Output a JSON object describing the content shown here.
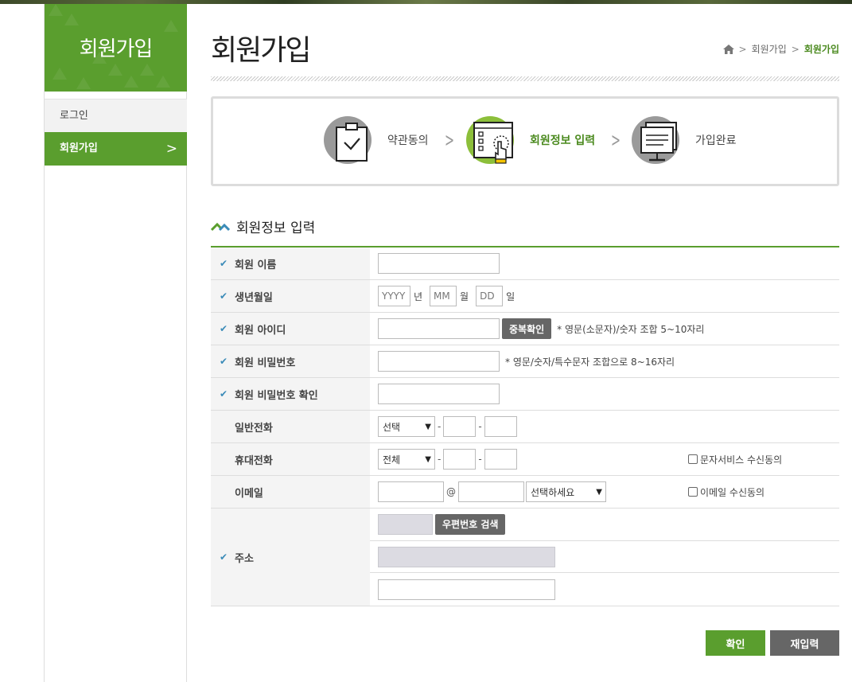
{
  "sidebar": {
    "title": "회원가입",
    "items": [
      {
        "label": "로그인"
      },
      {
        "label": "회원가입"
      }
    ]
  },
  "header": {
    "title": "회원가입",
    "breadcrumb": [
      "회원가입",
      "회원가입"
    ]
  },
  "steps": [
    {
      "label": "약관동의",
      "icon": "clipboard-check-icon"
    },
    {
      "label": "회원정보 입력",
      "icon": "form-click-icon"
    },
    {
      "label": "가입완료",
      "icon": "monitor-icon"
    }
  ],
  "section": {
    "title": "회원정보 입력"
  },
  "form": {
    "name": {
      "label": "회원 이름"
    },
    "birth": {
      "label": "생년월일",
      "year_placeholder": "YYYY",
      "year_unit": "년",
      "month_placeholder": "MM",
      "month_unit": "월",
      "day_placeholder": "DD",
      "day_unit": "일"
    },
    "userid": {
      "label": "회원 아이디",
      "button": "중복확인",
      "note": "* 영문(소문자)/숫자 조합 5~10자리"
    },
    "password": {
      "label": "회원 비밀번호",
      "note": "* 영문/숫자/특수문자 조합으로 8~16자리"
    },
    "password_confirm": {
      "label": "회원 비밀번호 확인"
    },
    "phone": {
      "label": "일반전화",
      "select": "선택",
      "dash": "-"
    },
    "mobile": {
      "label": "휴대전화",
      "select": "전체",
      "dash": "-",
      "agree": "문자서비스 수신동의"
    },
    "email": {
      "label": "이메일",
      "at": "@",
      "select": "선택하세요",
      "agree": "이메일 수신동의"
    },
    "address": {
      "label": "주소",
      "button": "우편번호 검색"
    }
  },
  "actions": {
    "confirm": "확인",
    "reset": "재입력"
  },
  "colors": {
    "accent": "#5a9e2e",
    "check": "#3a8bb8",
    "dark_button": "#666666"
  }
}
